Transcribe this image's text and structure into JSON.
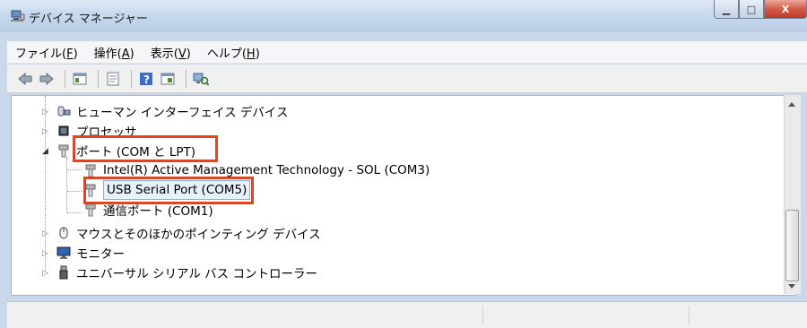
{
  "window": {
    "title": "デバイス マネージャー",
    "icon": "device-manager-icon",
    "buttons": {
      "minimize": "▁",
      "maximize": "□",
      "close": "X"
    }
  },
  "menu": [
    {
      "label": "ファイル",
      "key": "F"
    },
    {
      "label": "操作",
      "key": "A"
    },
    {
      "label": "表示",
      "key": "V"
    },
    {
      "label": "ヘルプ",
      "key": "H"
    }
  ],
  "toolbar": [
    "back-icon",
    "forward-icon",
    "properties-icon",
    "console-tree-icon",
    "help-icon",
    "view-icon",
    "scan-hardware-icon"
  ],
  "tree": [
    {
      "label": "ヒューマン インターフェイス デバイス",
      "icon": "hid-icon",
      "level": 1,
      "expander": "collapsed"
    },
    {
      "label": "プロセッサ",
      "icon": "processor-icon",
      "level": 1,
      "expander": "collapsed"
    },
    {
      "label": "ポート (COM と LPT)",
      "icon": "port-icon",
      "level": 1,
      "expander": "expanded",
      "highlighted": true
    },
    {
      "label": "Intel(R) Active Management Technology - SOL (COM3)",
      "icon": "port-icon",
      "level": 2
    },
    {
      "label": "USB Serial Port (COM5)",
      "icon": "port-icon",
      "level": 2,
      "selected": true,
      "highlighted": true
    },
    {
      "label": "通信ポート (COM1)",
      "icon": "port-icon",
      "level": 2
    },
    {
      "label": "マウスとそのほかのポインティング デバイス",
      "icon": "mouse-icon",
      "level": 1,
      "expander": "collapsed"
    },
    {
      "label": "モニター",
      "icon": "monitor-icon",
      "level": 1,
      "expander": "collapsed"
    },
    {
      "label": "ユニバーサル シリアル バス コントローラー",
      "icon": "usb-icon",
      "level": 1,
      "expander": "collapsed"
    }
  ],
  "colors": {
    "highlight_border": "#e8421c",
    "selection_bg": "#e7f1fb"
  }
}
